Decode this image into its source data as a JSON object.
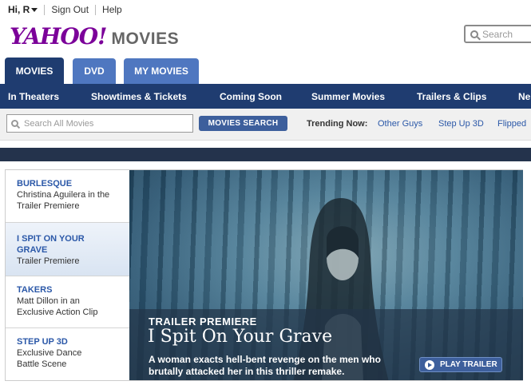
{
  "utility": {
    "user": "Hi, R",
    "sign_out": "Sign Out",
    "help": "Help"
  },
  "header": {
    "logo_text": "YAHOO!",
    "section": "MOVIES",
    "search_placeholder": "Search"
  },
  "tabs": [
    {
      "label": "MOVIES",
      "active": true
    },
    {
      "label": "DVD",
      "active": false
    },
    {
      "label": "MY MOVIES",
      "active": false
    }
  ],
  "nav": {
    "items": [
      "In Theaters",
      "Showtimes & Tickets",
      "Coming Soon",
      "Summer Movies",
      "Trailers & Clips",
      "Ne"
    ]
  },
  "searchbar": {
    "placeholder": "Search All Movies",
    "button": "MOVIES SEARCH",
    "trending_label": "Trending Now:",
    "trending": [
      "Other Guys",
      "Step Up 3D",
      "Flipped"
    ]
  },
  "feature": {
    "list": [
      {
        "title": "BURLESQUE",
        "desc1": "Christina Aguilera in the",
        "desc2": "Trailer Premiere",
        "active": false
      },
      {
        "title": "I SPIT ON YOUR",
        "title2": "GRAVE",
        "desc1": "Trailer Premiere",
        "active": true
      },
      {
        "title": "TAKERS",
        "desc1": "Matt Dillon in an",
        "desc2": "Exclusive Action Clip",
        "active": false
      },
      {
        "title": "STEP UP 3D",
        "desc1": "Exclusive Dance",
        "desc2": "Battle Scene",
        "active": false
      }
    ],
    "hero": {
      "kicker": "TRAILER PREMIERE",
      "title": "I Spit On Your Grave",
      "desc_line1": "A woman exacts hell-bent revenge on the men who",
      "desc_line2": "brutally attacked her in this thriller remake.",
      "button": "PLAY TRAILER"
    }
  },
  "colors": {
    "brand": "#7b0099",
    "navy": "#1f3c70",
    "tab_inactive": "#4f77c0",
    "link": "#2b58a8"
  }
}
